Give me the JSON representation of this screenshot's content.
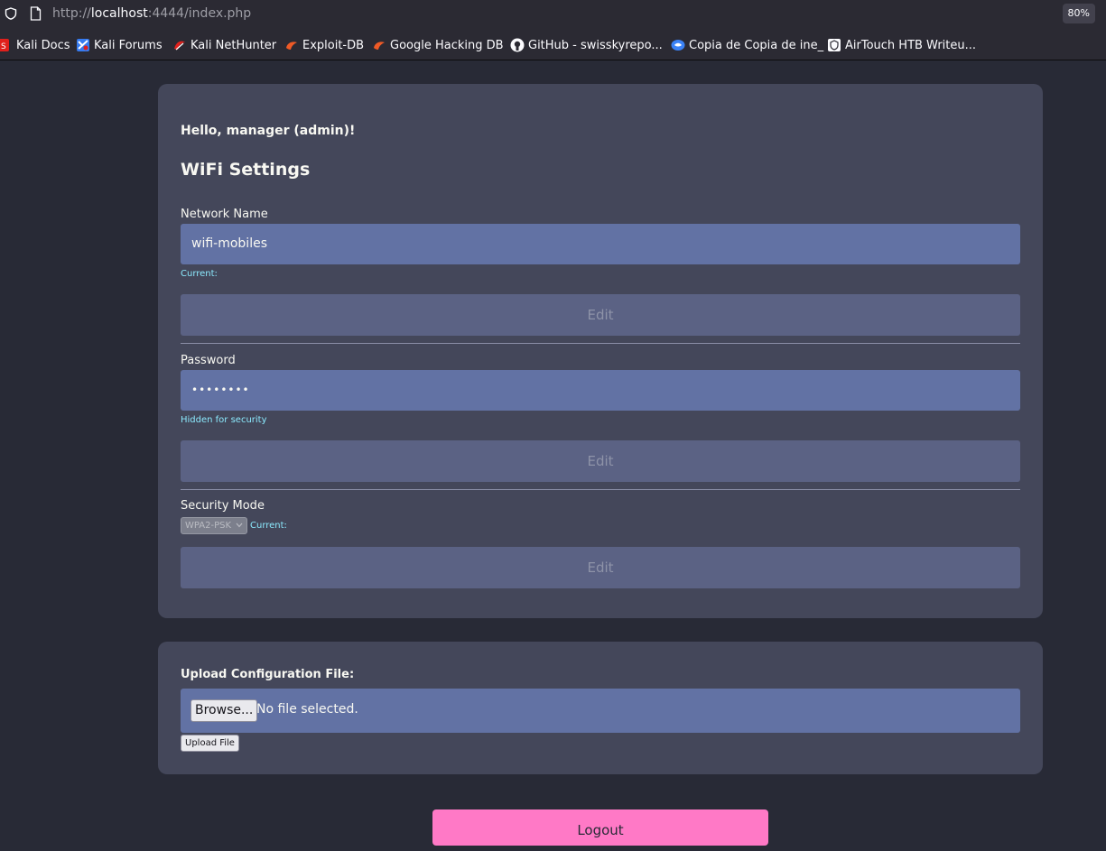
{
  "browser": {
    "url_prefix": "http://",
    "url_host": "localhost",
    "url_rest": ":4444/index.php",
    "zoom": "80%",
    "bookmarks": [
      {
        "label": "Kali Docs",
        "icon": "kali-docs-icon"
      },
      {
        "label": "Kali Forums",
        "icon": "kali-forums-icon"
      },
      {
        "label": "Kali NetHunter",
        "icon": "kali-nethunter-icon"
      },
      {
        "label": "Exploit-DB",
        "icon": "exploit-db-icon"
      },
      {
        "label": "Google Hacking DB",
        "icon": "google-hacking-db-icon"
      },
      {
        "label": "GitHub - swisskyrepo...",
        "icon": "github-icon"
      },
      {
        "label": "Copia de Copia de ine_",
        "icon": "bookmark-icon"
      },
      {
        "label": "AirTouch HTB Writeu...",
        "icon": "airtouch-icon"
      }
    ]
  },
  "settings": {
    "greeting": "Hello, manager (admin)!",
    "title": "WiFi Settings",
    "network": {
      "label": "Network Name",
      "value": "wifi-mobiles",
      "hint": "Current:",
      "edit": "Edit"
    },
    "password": {
      "label": "Password",
      "value": "••••••••",
      "hint": "Hidden for security",
      "edit": "Edit"
    },
    "security": {
      "label": "Security Mode",
      "selected": "WPA2-PSK",
      "hint": "Current:",
      "edit": "Edit"
    }
  },
  "upload": {
    "label": "Upload Configuration File:",
    "browse": "Browse...",
    "status": "No file selected.",
    "submit": "Upload File"
  },
  "logout": "Logout",
  "colors": {
    "background": "#282a36",
    "card": "#44475a",
    "field": "#6272a4",
    "hint": "#8be9fd",
    "logout": "#ff79c6"
  }
}
